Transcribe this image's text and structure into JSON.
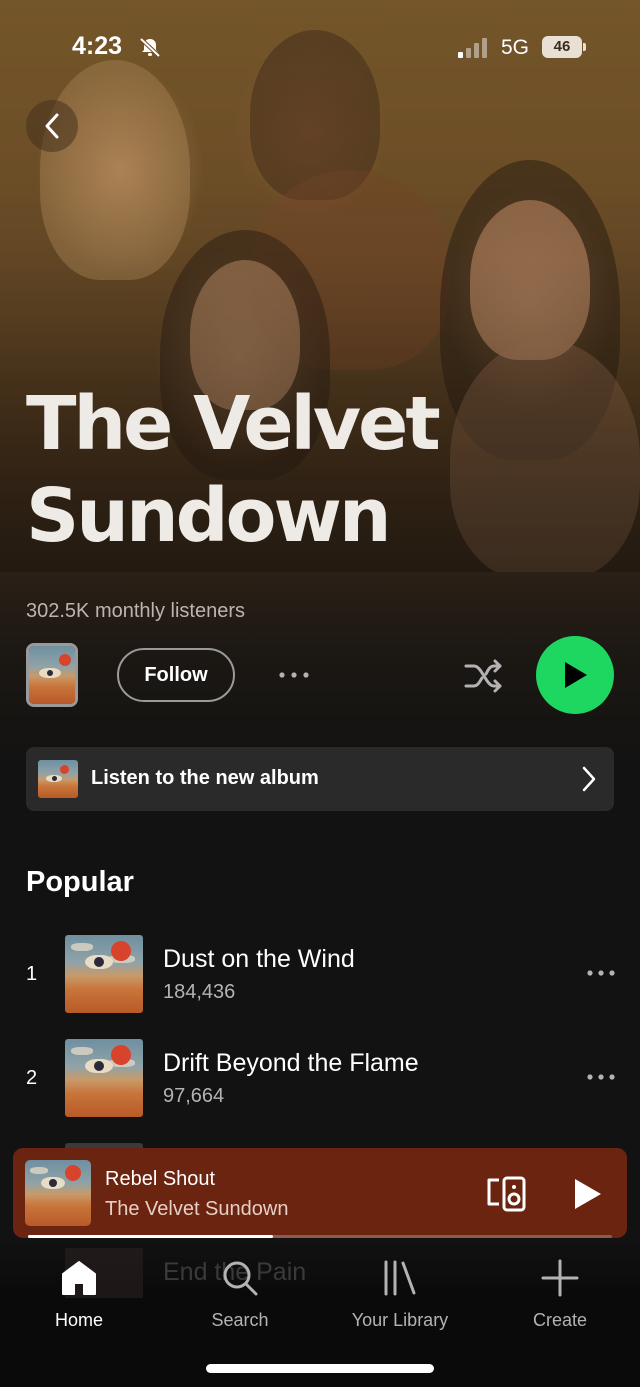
{
  "status_bar": {
    "time": "4:23",
    "network": "5G",
    "battery": "46"
  },
  "artist": {
    "name_line1": "The Velvet",
    "name_line2": "Sundown",
    "monthly_listeners": "302.5K monthly listeners"
  },
  "actions": {
    "follow_label": "Follow"
  },
  "promo": {
    "label": "Listen to the new album"
  },
  "popular": {
    "title": "Popular",
    "tracks": [
      {
        "rank": "1",
        "title": "Dust on the Wind",
        "plays": "184,436"
      },
      {
        "rank": "2",
        "title": "Drift Beyond the Flame",
        "plays": "97,664"
      }
    ],
    "hidden_track_title": "End the Pain"
  },
  "now_playing": {
    "title": "Rebel Shout",
    "artist": "The Velvet Sundown",
    "progress": 0.42
  },
  "nav": {
    "home": "Home",
    "search": "Search",
    "library": "Your Library",
    "create": "Create"
  },
  "colors": {
    "accent_green": "#1ed760",
    "now_playing_bg": "#6a2410",
    "background": "#121212"
  }
}
